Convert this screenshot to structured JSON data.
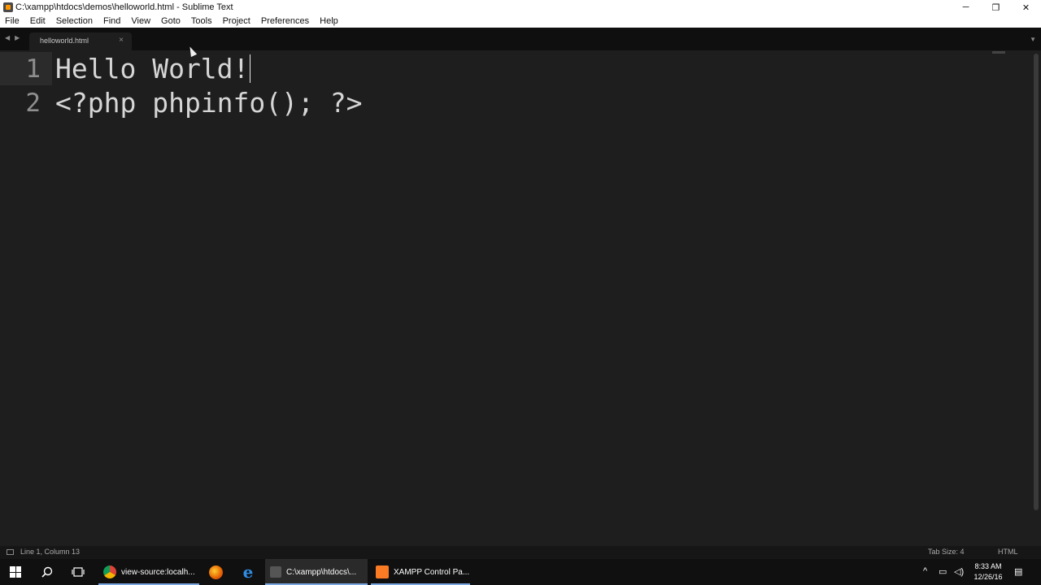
{
  "window": {
    "title": "C:\\xampp\\htdocs\\demos\\helloworld.html - Sublime Text",
    "minimize_glyph": "─",
    "restore_glyph": "❐",
    "close_glyph": "✕"
  },
  "menu": [
    "File",
    "Edit",
    "Selection",
    "Find",
    "View",
    "Goto",
    "Tools",
    "Project",
    "Preferences",
    "Help"
  ],
  "tabs": {
    "nav_back": "◀",
    "nav_forward": "▶",
    "items": [
      {
        "label": "helloworld.html",
        "close": "×"
      }
    ],
    "dropdown": "▼"
  },
  "editor": {
    "lines": [
      {
        "number": "1",
        "text": "Hello World!"
      },
      {
        "number": "2",
        "text": "<?php phpinfo(); ?>"
      }
    ]
  },
  "status": {
    "position": "Line 1, Column 13",
    "tab_size": "Tab Size: 4",
    "syntax": "HTML"
  },
  "taskbar": {
    "apps": [
      {
        "label": "view-source:localh...",
        "icon": "chrome-icon"
      },
      {
        "label": "C:\\xampp\\htdocs\\...",
        "icon": "sublime-icon"
      },
      {
        "label": "XAMPP Control Pa...",
        "icon": "xampp-icon"
      }
    ],
    "clock": {
      "time": "8:33 AM",
      "date": "12/26/16"
    }
  },
  "colors": {
    "editor_bg": "#1e1e1e",
    "text": "#d6d6d6",
    "gutter": "#8e8e8e",
    "accent": "#7aa7e0"
  }
}
